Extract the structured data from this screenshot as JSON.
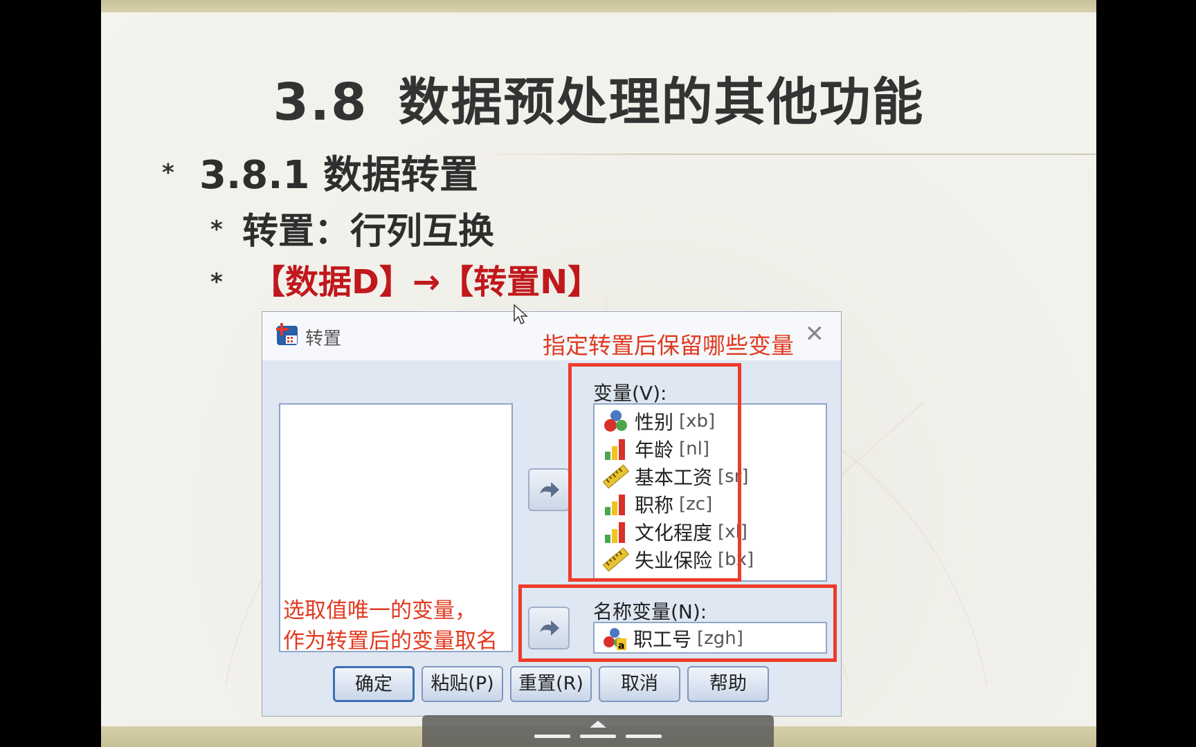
{
  "slide": {
    "title_num": "3.8",
    "title_text": "数据预处理的其他功能",
    "h1": "3.8.1 数据转置",
    "h2": "转置：行列互换",
    "h3": "【数据D】→【转置N】",
    "bullet_glyph": "*"
  },
  "dialog": {
    "title": "转置",
    "close_glyph": "✕",
    "annotation_top": "指定转置后保留哪些变量",
    "annotation_left_1": "选取值唯一的变量，",
    "annotation_left_2": "作为转置后的变量取名",
    "variables_label": "变量(V):",
    "variables": [
      {
        "name": "性别",
        "code": "[xb]",
        "icon": "nominal-icon"
      },
      {
        "name": "年龄",
        "code": "[nl]",
        "icon": "ordinal-icon"
      },
      {
        "name": "基本工资",
        "code": "[sr]",
        "icon": "scale-icon"
      },
      {
        "name": "职称",
        "code": "[zc]",
        "icon": "ordinal-icon"
      },
      {
        "name": "文化程度",
        "code": "[xl]",
        "icon": "ordinal-icon"
      },
      {
        "name": "失业保险",
        "code": "[bx]",
        "icon": "scale-icon"
      }
    ],
    "name_variable_label": "名称变量(N):",
    "name_variable": {
      "name": "职工号",
      "code": "[zgh]",
      "icon": "string-nominal-icon"
    },
    "buttons": {
      "ok": "确定",
      "paste": "粘贴(P)",
      "reset": "重置(R)",
      "cancel": "取消",
      "help": "帮助"
    }
  },
  "colors": {
    "annotation_red": "#e03a20",
    "heading_red": "#c0181c",
    "highlight_box": "#ee3b2b"
  }
}
